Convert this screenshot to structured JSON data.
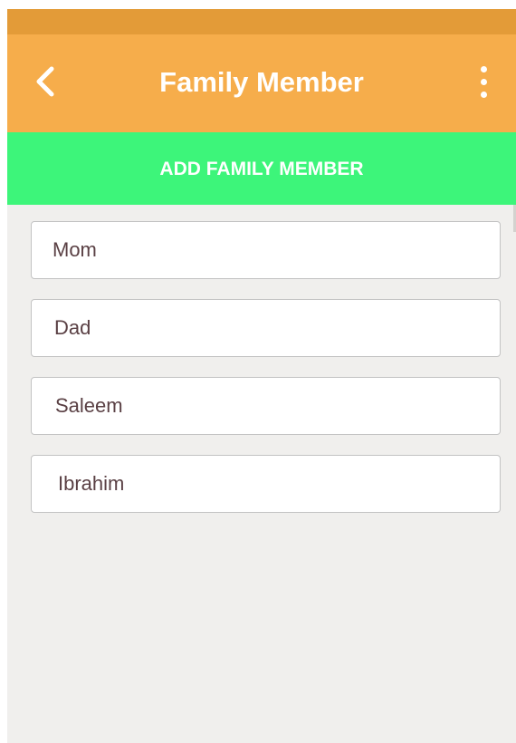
{
  "app_bar": {
    "title": "Family Member",
    "back_icon": "chevron-left-icon",
    "menu_icon": "more-vertical-icon"
  },
  "add_button": {
    "label": "ADD FAMILY MEMBER"
  },
  "members": [
    {
      "name": "Mom"
    },
    {
      "name": "Dad"
    },
    {
      "name": "Saleem"
    },
    {
      "name": "Ibrahim"
    }
  ],
  "colors": {
    "status_bar": "#e39b38",
    "app_bar": "#f6ad4b",
    "add_button": "#3df57a",
    "background": "#f0efed",
    "member_text": "#5a4044"
  }
}
